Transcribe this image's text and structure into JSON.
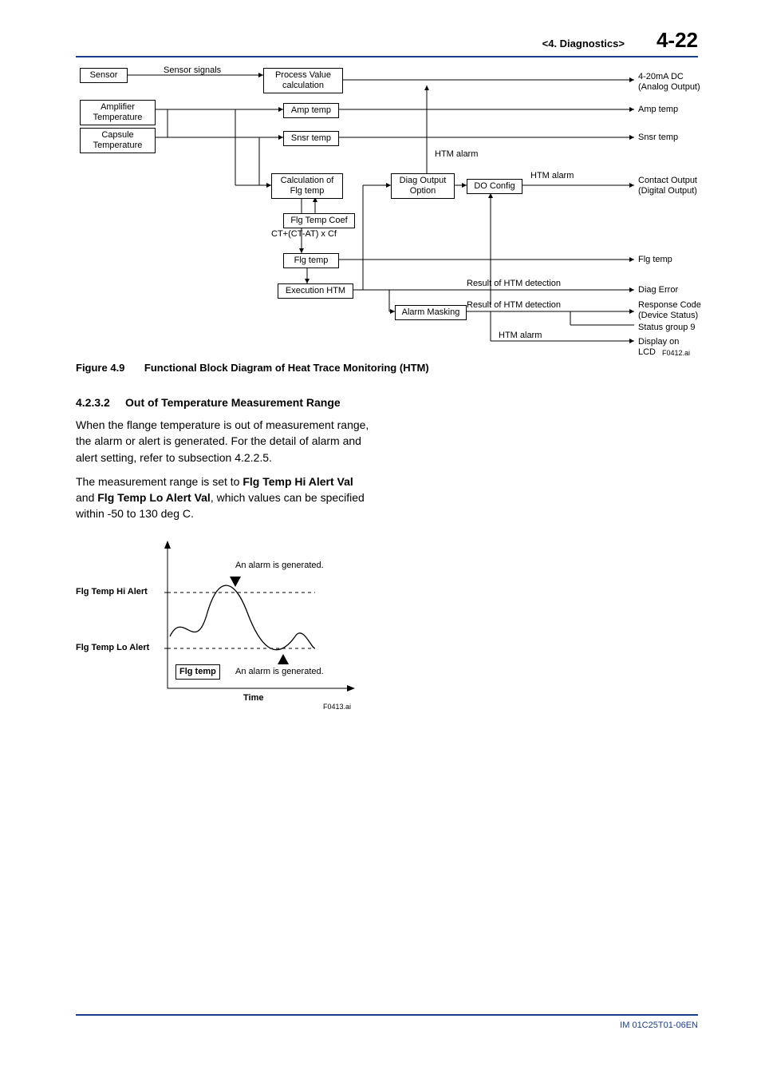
{
  "header": {
    "chapter": "<4.  Diagnostics>",
    "page": "4-22"
  },
  "footer": {
    "doc": "IM 01C25T01-06EN"
  },
  "fig49": {
    "caption_no": "Figure 4.9",
    "caption_txt": "Functional Block Diagram of Heat Trace Monitoring (HTM)",
    "ref": "F0412.ai",
    "boxes": {
      "sensor": "Sensor",
      "amp_t": "Amplifier\nTemperature",
      "cap_t": "Capsule\nTemperature",
      "pv": "Process Value\ncalculation",
      "amp_temp": "Amp temp",
      "snsr_temp": "Snsr temp",
      "calc_flg": "Calculation of\nFlg temp",
      "coef": "Flg Temp Coef",
      "flg_temp": "Flg temp",
      "exec_htm": "Execution HTM",
      "diag_out": "Diag Output\nOption",
      "do_config": "DO Config",
      "alarm_mask": "Alarm Masking"
    },
    "labels": {
      "sensor_signals": "Sensor signals",
      "formula": "CT+(CT-AT) x Cf",
      "htm_alarm": "HTM alarm",
      "res_htm1": "Result of HTM detection",
      "res_htm2": "Result of HTM detection",
      "out1": "4-20mA DC\n(Analog Output)",
      "out_amp": "Amp temp",
      "out_snsr": "Snsr temp",
      "out_contact": "Contact Output\n(Digital Output)",
      "out_flg": "Flg temp",
      "out_diag": "Diag Error",
      "out_resp": "Response Code\n(Device Status)",
      "out_stat": "Status group 9",
      "out_disp": "Display on LCD"
    }
  },
  "section": {
    "num": "4.2.3.2",
    "title": "Out of Temperature Measurement Range",
    "p1": "When the flange temperature is out of measurement range, the alarm or alert is generated. For the detail of alarm and alert setting, refer to subsection 4.2.2.5.",
    "p2a": "The measurement range is set to ",
    "p2b": "Flg Temp Hi Alert Val",
    "p2c": " and ",
    "p2d": "Flg Temp Lo Alert Val",
    "p2e": ", which values can be specified within -50 to 130 deg C."
  },
  "fig2": {
    "ref": "F0413.ai",
    "hi": "Flg Temp Hi Alert",
    "lo": "Flg Temp Lo Alert",
    "flg": "Flg temp",
    "time": "Time",
    "alarm": "An alarm is generated."
  }
}
